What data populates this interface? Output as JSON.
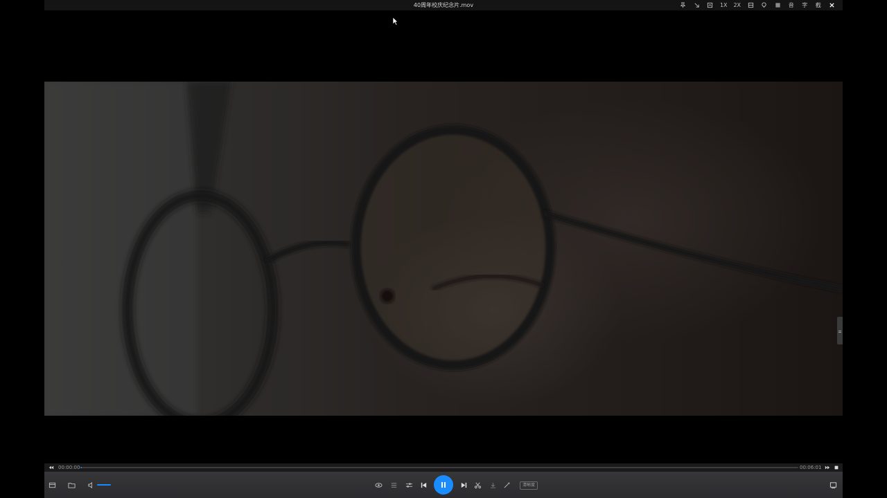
{
  "window": {
    "title": "40周年校庆纪念片.mov"
  },
  "title_bar_buttons": [
    {
      "name": "pin-icon",
      "label": ""
    },
    {
      "name": "mini-mode-icon",
      "label": ""
    },
    {
      "name": "crop-icon",
      "label": ""
    },
    {
      "name": "speed-1x-button",
      "label": "1X"
    },
    {
      "name": "speed-2x-button",
      "label": "2X"
    },
    {
      "name": "layout-icon",
      "label": ""
    },
    {
      "name": "bulb-icon",
      "label": ""
    },
    {
      "name": "grid-icon",
      "label": ""
    },
    {
      "name": "audio-track-button",
      "label": "音"
    },
    {
      "name": "subtitle-button",
      "label": "字"
    },
    {
      "name": "screenshot-button",
      "label": "截"
    }
  ],
  "progress": {
    "current_time": "00:00:00",
    "total_time": "00:06:01",
    "fraction": 0.0
  },
  "controls": {
    "quality_label": "清晰度",
    "volume_fraction": 1.0,
    "accent_color": "#1a8cff"
  }
}
